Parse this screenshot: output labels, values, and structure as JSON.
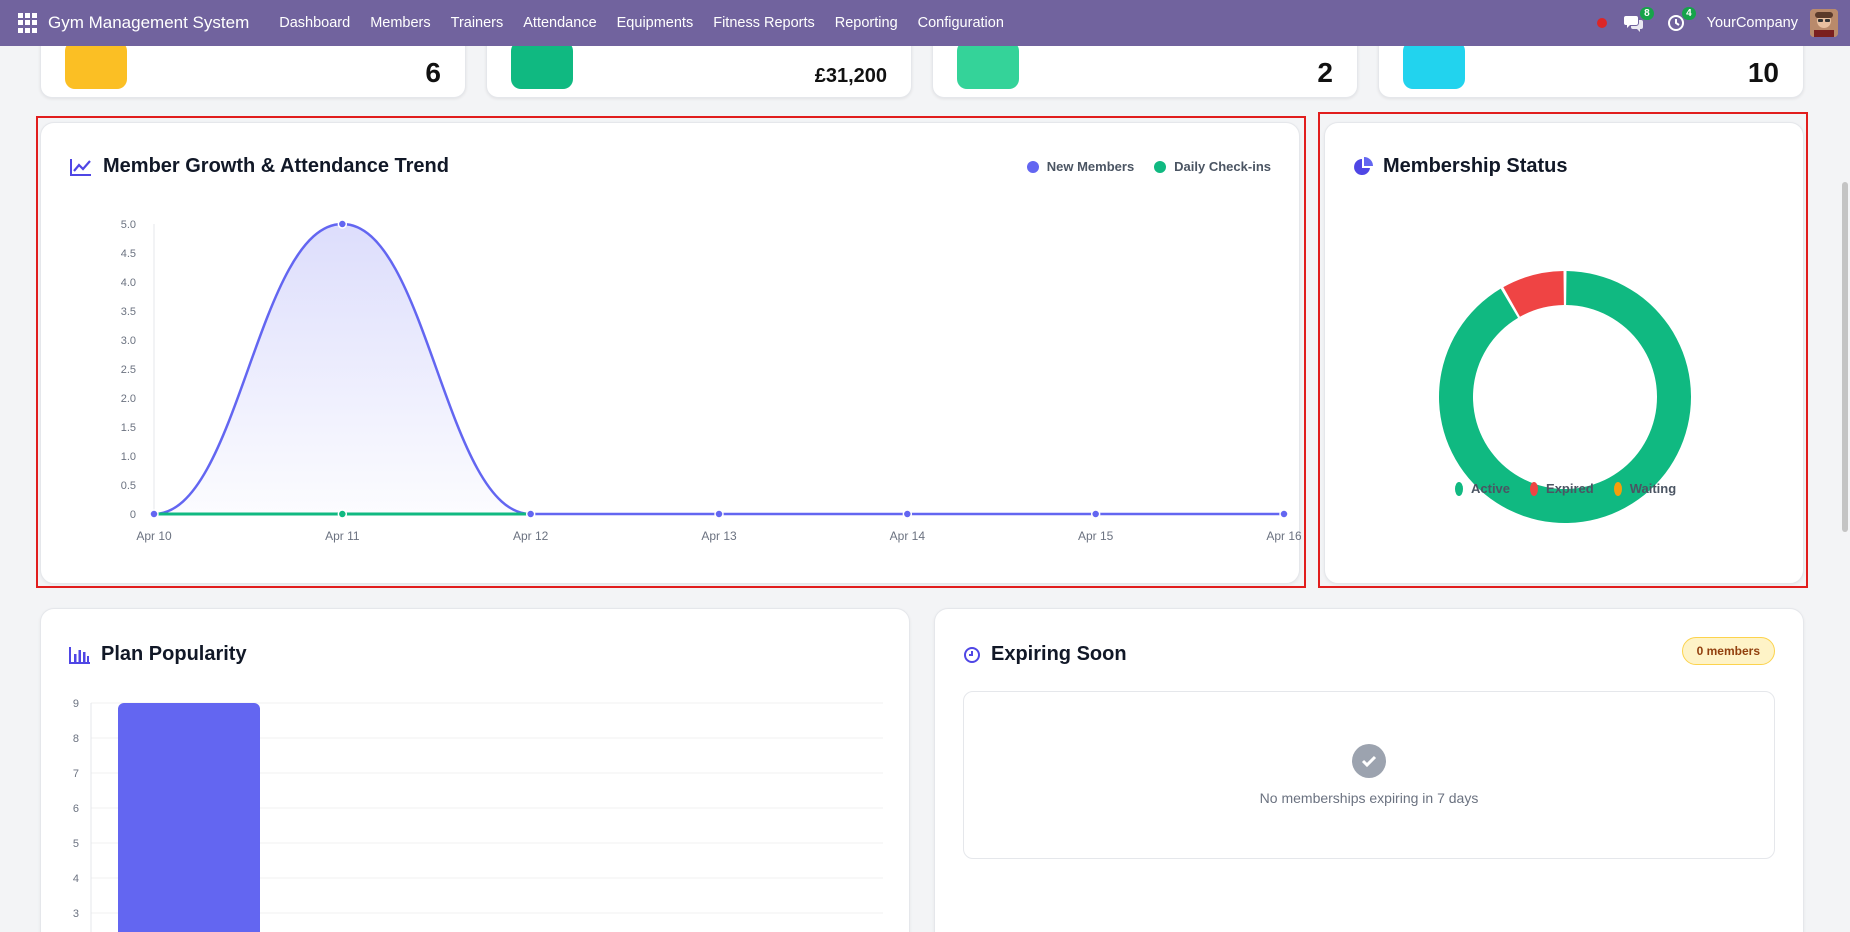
{
  "navbar": {
    "brand": "Gym Management System",
    "menu": [
      "Dashboard",
      "Members",
      "Trainers",
      "Attendance",
      "Equipments",
      "Fitness Reports",
      "Reporting",
      "Configuration"
    ],
    "messages_count": "8",
    "activity_count": "4",
    "company": "YourCompany"
  },
  "stats": [
    {
      "value": "6",
      "color": "#fbbf24"
    },
    {
      "value": "£31,200",
      "color": "#10b981"
    },
    {
      "value": "2",
      "color": "#34d399"
    },
    {
      "value": "10",
      "color": "#22d3ee"
    }
  ],
  "growth_panel": {
    "title": "Member Growth & Attendance Trend",
    "legend": [
      {
        "label": "New Members",
        "color": "#6366f1"
      },
      {
        "label": "Daily Check-ins",
        "color": "#10b981"
      }
    ]
  },
  "status_panel": {
    "title": "Membership Status",
    "legend": [
      {
        "label": "Active",
        "color": "#10b981"
      },
      {
        "label": "Expired",
        "color": "#ef4444"
      },
      {
        "label": "Waiting",
        "color": "#f59e0b"
      }
    ]
  },
  "plan_panel": {
    "title": "Plan Popularity"
  },
  "expiring_panel": {
    "title": "Expiring Soon",
    "badge": "0 members",
    "empty_message": "No memberships expiring in 7 days"
  },
  "chart_data": [
    {
      "type": "line",
      "x": [
        "Apr 10",
        "Apr 11",
        "Apr 12",
        "Apr 13",
        "Apr 14",
        "Apr 15",
        "Apr 16"
      ],
      "series": [
        {
          "name": "New Members",
          "values": [
            0,
            5,
            0,
            0,
            0,
            0,
            0
          ],
          "color": "#6366f1"
        },
        {
          "name": "Daily Check-ins",
          "values": [
            0,
            0,
            0,
            0,
            0,
            0,
            0
          ],
          "color": "#10b981"
        }
      ],
      "yticks": [
        "0",
        "0.5",
        "1.0",
        "1.5",
        "2.0",
        "2.5",
        "3.0",
        "3.5",
        "4.0",
        "4.5",
        "5.0"
      ],
      "ylim": [
        0,
        5
      ]
    },
    {
      "type": "pie",
      "labels": [
        "Active",
        "Expired",
        "Waiting"
      ],
      "values": [
        11,
        1,
        0
      ],
      "colors": [
        "#10b981",
        "#ef4444",
        "#f59e0b"
      ]
    },
    {
      "type": "bar",
      "values": [
        9
      ],
      "yticks": [
        "3",
        "4",
        "5",
        "6",
        "7",
        "8",
        "9"
      ],
      "ylim": [
        0,
        9
      ],
      "color": "#6366f1"
    }
  ]
}
